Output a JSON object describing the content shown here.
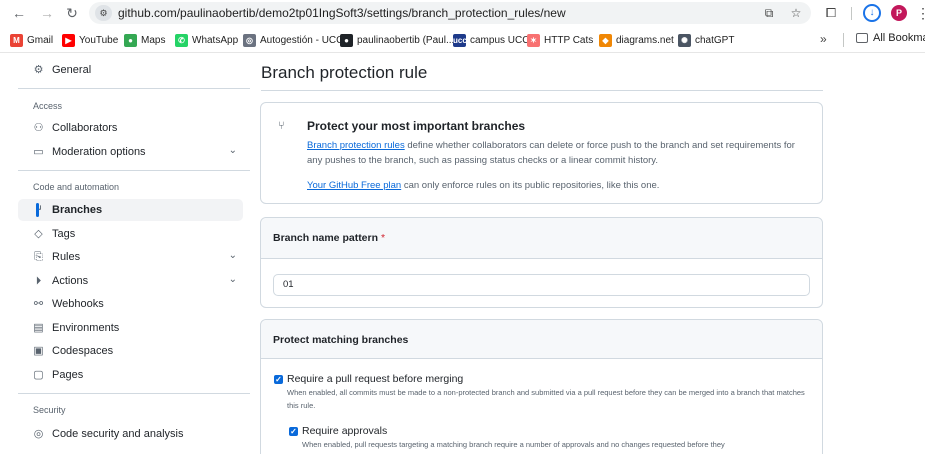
{
  "browser": {
    "url": "github.com/paulinaobertib/demo2tp01IngSoft3/settings/branch_protection_rules/new",
    "profile_initial": "P",
    "bookmarks": [
      {
        "label": "Gmail",
        "icon": "gmail-icon",
        "color": "#ea4335",
        "glyph": "M"
      },
      {
        "label": "YouTube",
        "icon": "youtube-icon",
        "color": "#ff0000",
        "glyph": "▶"
      },
      {
        "label": "Maps",
        "icon": "maps-icon",
        "color": "#34a853",
        "glyph": "●"
      },
      {
        "label": "WhatsApp",
        "icon": "whatsapp-icon",
        "color": "#25d366",
        "glyph": "✆"
      },
      {
        "label": "Autogestión - UCC",
        "icon": "ucc-icon",
        "color": "#6b7280",
        "glyph": "◎"
      },
      {
        "label": "paulinaobertib (Paul...",
        "icon": "github-icon",
        "color": "#1f2328",
        "glyph": "●"
      },
      {
        "label": "campus UCC",
        "icon": "campus-icon",
        "color": "#1e3a8a",
        "glyph": "ucc"
      },
      {
        "label": "HTTP Cats",
        "icon": "http-cats-icon",
        "color": "#f87171",
        "glyph": "✶"
      },
      {
        "label": "diagrams.net",
        "icon": "diagrams-icon",
        "color": "#f08705",
        "glyph": "◆"
      },
      {
        "label": "chatGPT",
        "icon": "chatgpt-icon",
        "color": "#4b5563",
        "glyph": "✺"
      }
    ],
    "bookmarks_more": "»",
    "all_bookmarks": "All Bookmarks"
  },
  "sidebar": {
    "general": "General",
    "access_heading": "Access",
    "collaborators": "Collaborators",
    "moderation": "Moderation options",
    "code_heading": "Code and automation",
    "branches": "Branches",
    "tags": "Tags",
    "rules": "Rules",
    "actions": "Actions",
    "webhooks": "Webhooks",
    "environments": "Environments",
    "codespaces": "Codespaces",
    "pages": "Pages",
    "security_heading": "Security",
    "code_security": "Code security and analysis"
  },
  "main": {
    "title": "Branch protection rule",
    "intro": {
      "heading": "Protect your most important branches",
      "link": "Branch protection rules",
      "text": " define whether collaborators can delete or force push to the branch and set requirements for any pushes to the branch, such as passing status checks or a linear commit history.",
      "plan_link": "Your GitHub Free plan",
      "plan_text": " can only enforce rules on its public repositories, like this one."
    },
    "pattern": {
      "label": "Branch name pattern",
      "required": "*",
      "value": "01"
    },
    "protect": {
      "heading": "Protect matching branches",
      "options": [
        {
          "label": "Require a pull request before merging",
          "checked": true,
          "description": "When enabled, all commits must be made to a non-protected branch and submitted via a pull request before they can be merged into a branch that matches this rule."
        },
        {
          "label": "Require approvals",
          "checked": true,
          "description": "When enabled, pull requests targeting a matching branch require a number of approvals and no changes requested before they"
        }
      ]
    }
  }
}
